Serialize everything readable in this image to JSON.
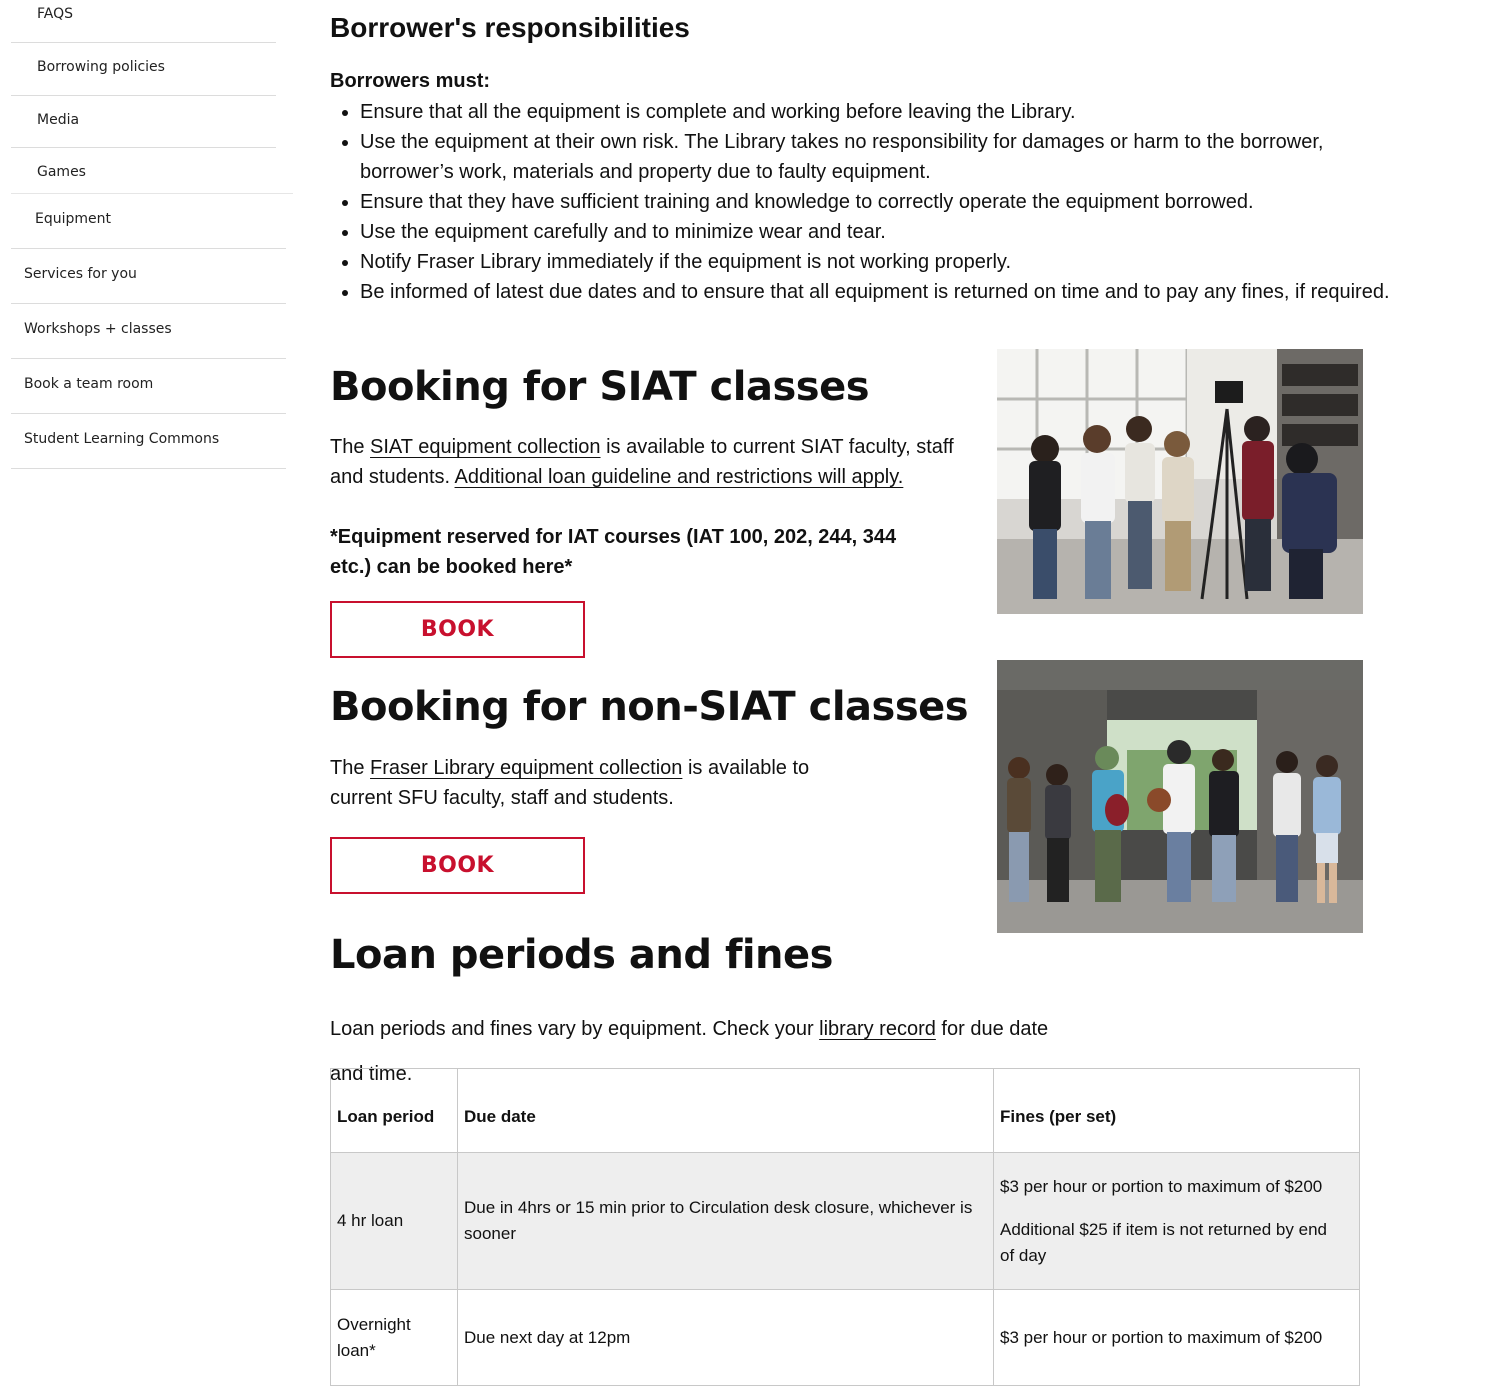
{
  "sidebar": {
    "sub_items": [
      {
        "label": "FAQS"
      },
      {
        "label": "Borrowing policies"
      },
      {
        "label": "Media"
      },
      {
        "label": "Games"
      },
      {
        "label": "Equipment"
      }
    ],
    "items": [
      {
        "label": "Services for you"
      },
      {
        "label": "Workshops + classes"
      },
      {
        "label": "Book a team room"
      },
      {
        "label": "Student Learning Commons"
      }
    ]
  },
  "responsibilities": {
    "heading": "Borrower's responsibilities",
    "lead": "Borrowers must:",
    "items": [
      "Ensure that all the equipment is complete and working before leaving the Library.",
      "Use the equipment at their own risk. The Library takes no responsibility for damages or harm to the borrower, borrower’s work, materials and property due to faulty equipment.",
      "Ensure that they have sufficient training and knowledge to correctly operate the equipment borrowed.",
      "Use the equipment carefully and to minimize wear and tear.",
      "Notify Fraser Library immediately if the equipment is not working properly.",
      "Be informed of latest due dates and to ensure that all equipment is returned on time and to pay any fines, if required."
    ]
  },
  "siat": {
    "heading": "Booking for SIAT classes",
    "text_pre": "The ",
    "link1": "SIAT equipment collection",
    "text_mid": " is available to current SIAT faculty, staff and students. ",
    "link2": "Additional loan guideline and restrictions will apply.",
    "note": "*Equipment reserved for IAT courses (IAT 100, 202, 244, 344 etc.) can be booked here*",
    "button": "BOOK"
  },
  "nonsiat": {
    "heading": "Booking for non-SIAT classes",
    "text_pre": "The ",
    "link": "Fraser Library equipment collection",
    "text_post": " is available to current SFU faculty, staff and students.",
    "button": "BOOK"
  },
  "loans": {
    "heading": "Loan periods and fines",
    "intro_pre": "Loan periods and fines vary by equipment. Check your ",
    "intro_link": "library record",
    "intro_post": " for due date",
    "intro_wrap": "and time.",
    "table": {
      "headers": [
        "Loan period",
        "Due date",
        "Fines (per set)"
      ],
      "rows": [
        {
          "period": "4 hr loan",
          "due": "Due in 4hrs or 15 min prior to Circulation desk closure, whichever is sooner",
          "fine1": "$3 per hour or portion to maximum of $200",
          "fine2": "Additional $25 if item is not returned by end of day"
        },
        {
          "period": "Overnight loan*",
          "due": "Due next day at 12pm",
          "fine1": "$3 per hour or portion to maximum of $200"
        }
      ]
    }
  },
  "colors": {
    "accent": "#c8102e",
    "row_alt": "#eeeeee",
    "divider": "#dcdcdc"
  }
}
